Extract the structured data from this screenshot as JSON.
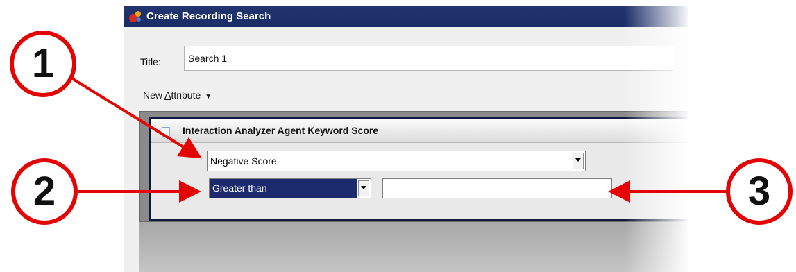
{
  "window": {
    "title": "Create Recording Search"
  },
  "form": {
    "title_label": "Title:",
    "title_value": "Search 1",
    "new_attribute_prefix": "New ",
    "new_attribute_underlined": "A",
    "new_attribute_suffix": "ttribute"
  },
  "attribute": {
    "header": "Interaction Analyzer Agent Keyword Score",
    "score_type": "Negative Score",
    "operator": "Greater than",
    "value": ""
  },
  "callouts": {
    "one": "1",
    "two": "2",
    "three": "3"
  },
  "colors": {
    "callout_red": "#e40404",
    "titlebar": "#1f3170",
    "selection": "#1b2b6d"
  }
}
